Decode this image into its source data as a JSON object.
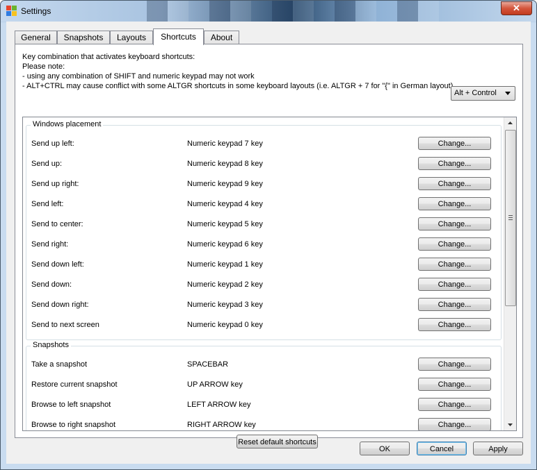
{
  "window": {
    "title": "Settings",
    "close_label": "✕"
  },
  "tabs": [
    {
      "label": "General"
    },
    {
      "label": "Snapshots"
    },
    {
      "label": "Layouts"
    },
    {
      "label": "Shortcuts"
    },
    {
      "label": "About"
    }
  ],
  "active_tab": "Shortcuts",
  "note": {
    "line1": "Key combination that activates keyboard shortcuts:",
    "line2": "Please note:",
    "line3": "- using any combination of SHIFT and numeric keypad may not work",
    "line4": "- ALT+CTRL may cause conflict with some ALTGR shortcuts in some keyboard layouts (i.e. ALTGR + 7 for \"{\" in German layout)"
  },
  "modifier_select": {
    "value": "Alt + Control"
  },
  "groups": {
    "windows_placement": {
      "title": "Windows placement",
      "rows": [
        {
          "label": "Send up left:",
          "key": "Numeric keypad 7 key",
          "button": "Change..."
        },
        {
          "label": "Send up:",
          "key": "Numeric keypad 8 key",
          "button": "Change..."
        },
        {
          "label": "Send up right:",
          "key": "Numeric keypad 9 key",
          "button": "Change..."
        },
        {
          "label": "Send left:",
          "key": "Numeric keypad 4 key",
          "button": "Change..."
        },
        {
          "label": "Send to center:",
          "key": "Numeric keypad 5 key",
          "button": "Change..."
        },
        {
          "label": "Send right:",
          "key": "Numeric keypad 6 key",
          "button": "Change..."
        },
        {
          "label": "Send down left:",
          "key": "Numeric keypad 1 key",
          "button": "Change..."
        },
        {
          "label": "Send down:",
          "key": "Numeric keypad 2 key",
          "button": "Change..."
        },
        {
          "label": "Send down right:",
          "key": "Numeric keypad 3 key",
          "button": "Change..."
        },
        {
          "label": "Send to next screen",
          "key": "Numeric keypad 0 key",
          "button": "Change..."
        }
      ]
    },
    "snapshots": {
      "title": "Snapshots",
      "rows": [
        {
          "label": "Take a snapshot",
          "key": "SPACEBAR",
          "button": "Change..."
        },
        {
          "label": "Restore current snapshot",
          "key": "UP ARROW key",
          "button": "Change..."
        },
        {
          "label": "Browse to left snapshot",
          "key": "LEFT ARROW key",
          "button": "Change..."
        },
        {
          "label": "Browse to right snapshot",
          "key": "RIGHT ARROW key",
          "button": "Change..."
        }
      ]
    }
  },
  "reset_button": "Reset default shortcuts",
  "dialog_buttons": {
    "ok": "OK",
    "cancel": "Cancel",
    "apply": "Apply"
  },
  "icons": {
    "app": "app-windows-icon",
    "scroll_up": "scroll-up-arrow-icon",
    "scroll_down": "scroll-down-arrow-icon",
    "dropdown": "chevron-down-icon"
  }
}
